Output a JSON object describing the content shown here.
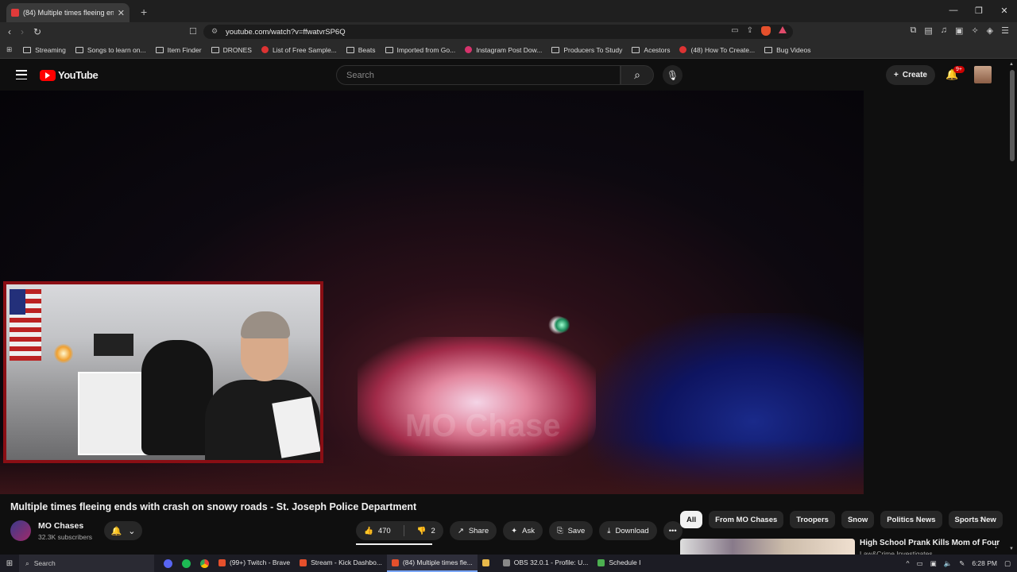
{
  "browser": {
    "tab_title": "(84) Multiple times fleeing en",
    "new_tab": "+",
    "url": "youtube.com/watch?v=ffwatvrSP6Q",
    "window_controls": [
      "—",
      "❐",
      "✕"
    ],
    "bookmarks": [
      {
        "label": "Streaming",
        "icon": "folder-icon"
      },
      {
        "label": "Songs to learn on...",
        "icon": "folder-icon"
      },
      {
        "label": "Item Finder",
        "icon": "folder-icon"
      },
      {
        "label": "DRONES",
        "icon": "folder-icon"
      },
      {
        "label": "List of Free Sample...",
        "icon": "site-icon"
      },
      {
        "label": "Beats",
        "icon": "folder-icon"
      },
      {
        "label": "Imported from Go...",
        "icon": "folder-icon"
      },
      {
        "label": "Instagram Post Dow...",
        "icon": "site-icon"
      },
      {
        "label": "Producers To Study",
        "icon": "folder-icon"
      },
      {
        "label": "Acestors",
        "icon": "folder-icon"
      },
      {
        "label": "(48) How To Create...",
        "icon": "youtube-icon"
      },
      {
        "label": "Bug Videos",
        "icon": "folder-icon"
      }
    ]
  },
  "youtube": {
    "logo_text": "YouTube",
    "search_placeholder": "Search",
    "create_label": "Create",
    "notif_badge": "9+",
    "video": {
      "watermark": "MO Chase",
      "title": "Multiple times fleeing ends with crash on snowy roads - St. Joseph Police Department",
      "channel": "MO Chases",
      "subscribers": "32.3K subscribers",
      "likes": "470",
      "dislikes": "2",
      "like_ratio": 0.996,
      "share": "Share",
      "ask": "Ask",
      "save": "Save",
      "download": "Download",
      "more": "•••"
    },
    "chips": [
      "All",
      "From MO Chases",
      "Troopers",
      "Snow",
      "Politics News",
      "Sports New"
    ],
    "recommended": {
      "title": "High School Prank Kills Mom of Four",
      "channel": "Law&Crime Investigates"
    }
  },
  "taskbar": {
    "search": "Search",
    "apps": [
      {
        "label": "(99+) Twitch - Brave",
        "color": "#e5502c"
      },
      {
        "label": "Stream - Kick Dashbo...",
        "color": "#e5502c"
      },
      {
        "label": "(84) Multiple times fle...",
        "color": "#e5502c",
        "active": true
      },
      {
        "label": "",
        "color": "#e8b84a"
      },
      {
        "label": "OBS 32.0.1 - Profile: U...",
        "color": "#888888"
      },
      {
        "label": "Schedule I",
        "color": "#4caf50"
      }
    ],
    "time": "6:28 PM"
  },
  "colors": {
    "accent_red": "#ff0000",
    "yt_bg": "#0f0f0f",
    "cam_border": "#8a0e14"
  }
}
